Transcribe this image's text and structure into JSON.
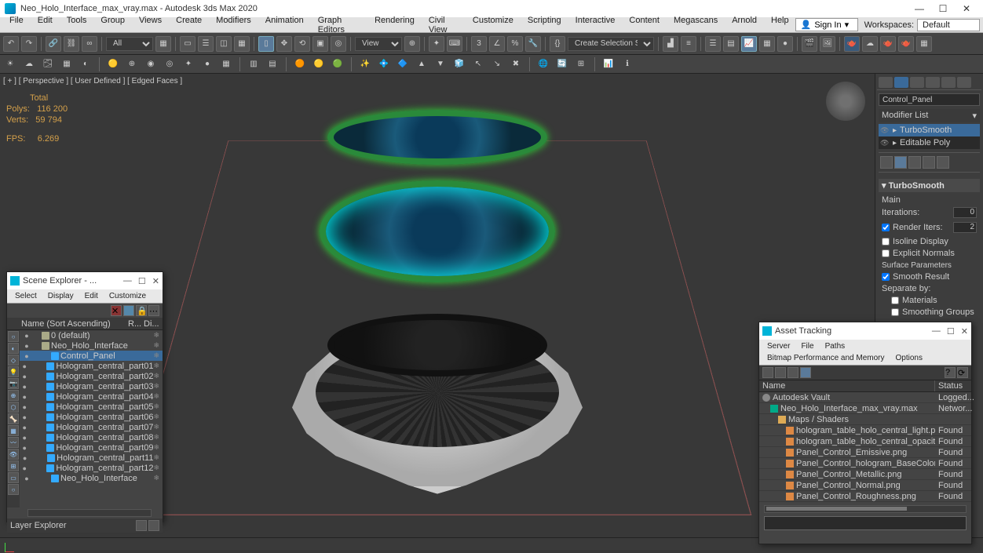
{
  "window": {
    "title": "Neo_Holo_Interface_max_vray.max - Autodesk 3ds Max 2020",
    "min": "—",
    "max": "☐",
    "close": "✕"
  },
  "menu": {
    "items": [
      "File",
      "Edit",
      "Tools",
      "Group",
      "Views",
      "Create",
      "Modifiers",
      "Animation",
      "Graph Editors",
      "Rendering",
      "Civil View",
      "Customize",
      "Scripting",
      "Interactive",
      "Content",
      "Megascans",
      "Arnold",
      "Help"
    ],
    "signin": "Sign In",
    "ws_label": "Workspaces:",
    "ws_value": "Default"
  },
  "toolbar": {
    "all": "All",
    "view": "View",
    "selset": "Create Selection Set"
  },
  "viewport": {
    "label": "[ + ]  [ Perspective ]  [ User Defined ]  [ Edged Faces ]",
    "stats_hdr": "Total",
    "polys_lbl": "Polys:",
    "polys": "116 200",
    "verts_lbl": "Verts:",
    "verts": "59 794",
    "fps_lbl": "FPS:",
    "fps": "6.269"
  },
  "panel": {
    "objname": "Control_Panel",
    "modlist_lbl": "Modifier List",
    "mods": [
      "TurboSmooth",
      "Editable Poly"
    ],
    "rollup_title": "TurboSmooth",
    "main_lbl": "Main",
    "iter_lbl": "Iterations:",
    "iter": "0",
    "rend_lbl": "Render Iters:",
    "rend": "2",
    "isoline": "Isoline Display",
    "explicit": "Explicit Normals",
    "surf_lbl": "Surface Parameters",
    "smooth": "Smooth Result",
    "sep_lbl": "Separate by:",
    "materials": "Materials",
    "smgroups": "Smoothing Groups"
  },
  "scene": {
    "title": "Scene Explorer - ...",
    "menus": [
      "Select",
      "Display",
      "Edit",
      "Customize"
    ],
    "col_name": "Name (Sort Ascending)",
    "col_r": "R...",
    "col_d": "Di...",
    "items": [
      {
        "ind": 1,
        "label": "0 (default)",
        "icon": "grp"
      },
      {
        "ind": 1,
        "label": "Neo_Holo_Interface",
        "icon": "grp",
        "sel": false,
        "bold": true
      },
      {
        "ind": 2,
        "label": "Control_Panel",
        "sel": true
      },
      {
        "ind": 2,
        "label": "Hologram_central_part01"
      },
      {
        "ind": 2,
        "label": "Hologram_central_part02"
      },
      {
        "ind": 2,
        "label": "Hologram_central_part03"
      },
      {
        "ind": 2,
        "label": "Hologram_central_part04"
      },
      {
        "ind": 2,
        "label": "Hologram_central_part05"
      },
      {
        "ind": 2,
        "label": "Hologram_central_part06"
      },
      {
        "ind": 2,
        "label": "Hologram_central_part07"
      },
      {
        "ind": 2,
        "label": "Hologram_central_part08"
      },
      {
        "ind": 2,
        "label": "Hologram_central_part09"
      },
      {
        "ind": 2,
        "label": "Hologram_central_part11"
      },
      {
        "ind": 2,
        "label": "Hologram_central_part12"
      },
      {
        "ind": 2,
        "label": "Neo_Holo_Interface"
      }
    ],
    "footer": "Layer Explorer"
  },
  "asset": {
    "title": "Asset Tracking",
    "menus": [
      "Server",
      "File",
      "Paths",
      "Bitmap Performance and Memory",
      "Options"
    ],
    "col_name": "Name",
    "col_status": "Status",
    "rows": [
      {
        "ind": 0,
        "icon": "vault",
        "name": "Autodesk Vault",
        "status": "Logged..."
      },
      {
        "ind": 1,
        "icon": "max",
        "name": "Neo_Holo_Interface_max_vray.max",
        "status": "Networ..."
      },
      {
        "ind": 2,
        "icon": "fold",
        "name": "Maps / Shaders",
        "status": ""
      },
      {
        "ind": 3,
        "icon": "img",
        "name": "hologram_table_holo_central_light.png",
        "status": "Found"
      },
      {
        "ind": 3,
        "icon": "img",
        "name": "hologram_table_holo_central_opacity.png",
        "status": "Found"
      },
      {
        "ind": 3,
        "icon": "img",
        "name": "Panel_Control_Emissive.png",
        "status": "Found"
      },
      {
        "ind": 3,
        "icon": "img",
        "name": "Panel_Control_hologram_BaseColor.png",
        "status": "Found"
      },
      {
        "ind": 3,
        "icon": "img",
        "name": "Panel_Control_Metallic.png",
        "status": "Found"
      },
      {
        "ind": 3,
        "icon": "img",
        "name": "Panel_Control_Normal.png",
        "status": "Found"
      },
      {
        "ind": 3,
        "icon": "img",
        "name": "Panel_Control_Roughness.png",
        "status": "Found"
      }
    ]
  }
}
